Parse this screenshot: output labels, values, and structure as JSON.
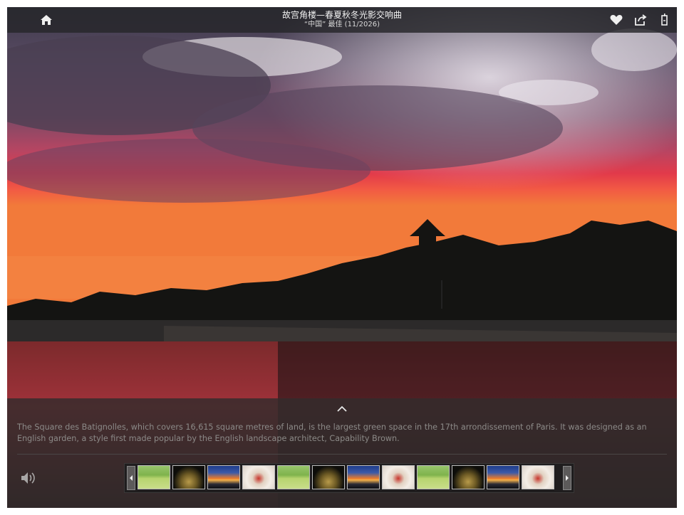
{
  "header": {
    "title": "故宫角楼—春夏秋冬光影交响曲",
    "subtitle": "“中国” 最佳 (11/2026)"
  },
  "icons": {
    "home": "home-icon",
    "favorite": "heart-icon",
    "share": "share-icon",
    "menu": "menu-icon",
    "expand": "chevron-up-icon",
    "sound": "speaker-icon",
    "prev": "chevron-left-icon",
    "next": "chevron-right-icon"
  },
  "caption": "The Square des Batignolles, which covers 16,615 square metres of land, is the largest green space in the 17th arrondissement of Paris. It was designed as an English garden, a style first made popular by the English landscape architect, Capability Brown.",
  "filmstrip": {
    "thumbnails": [
      "grass",
      "dragon",
      "sunset",
      "feast",
      "grass",
      "dragon",
      "sunset",
      "feast",
      "grass",
      "dragon",
      "sunset",
      "feast"
    ]
  },
  "colors": {
    "toolbar": "#26262a",
    "caption_text": "#8c8a88",
    "sky_red": "#e23a4a",
    "sky_orange": "#f27a3a"
  }
}
